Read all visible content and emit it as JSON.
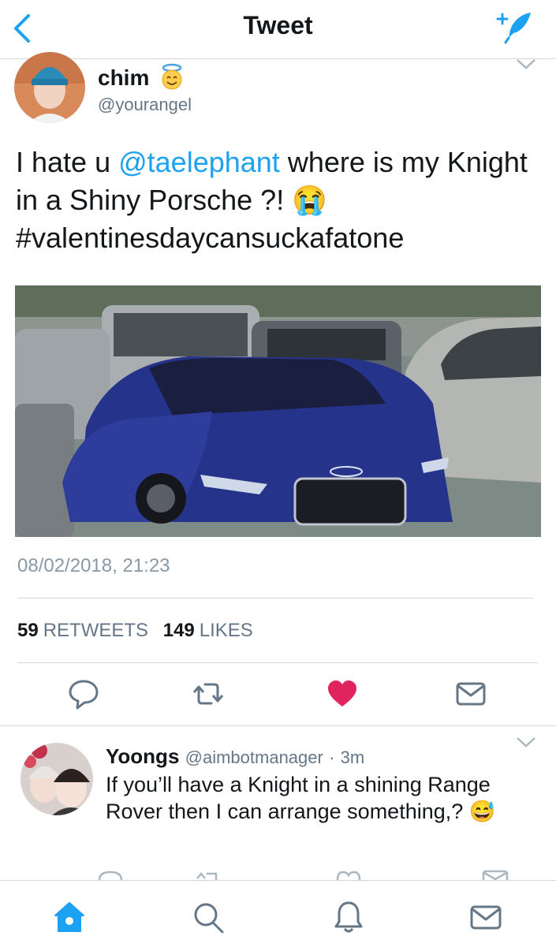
{
  "nav": {
    "title": "Tweet"
  },
  "tweet": {
    "name": "chim",
    "handle": "@yourangel",
    "text_prefix": "I hate u ",
    "mention": "@taelephant",
    "text_middle": " where is my Knight in a Shiny Porsche ?! ",
    "emoji": "😭",
    "hashtag": "#valentinesdaycansuckafatone",
    "timestamp": "08/02/2018, 21:23",
    "retweets_count": "59",
    "retweets_label": "RETWEETS",
    "likes_count": "149",
    "likes_label": "LIKES"
  },
  "reply": {
    "name": "Yoongs",
    "handle": "@aimbotmanager",
    "separator": "·",
    "time": "3m",
    "text": "If you’ll have a Knight in a shining Range Rover then I can arrange something,? ",
    "emoji": "😅"
  },
  "colors": {
    "accent": "#1da1f2",
    "like": "#e0245e",
    "muted": "#657786"
  }
}
